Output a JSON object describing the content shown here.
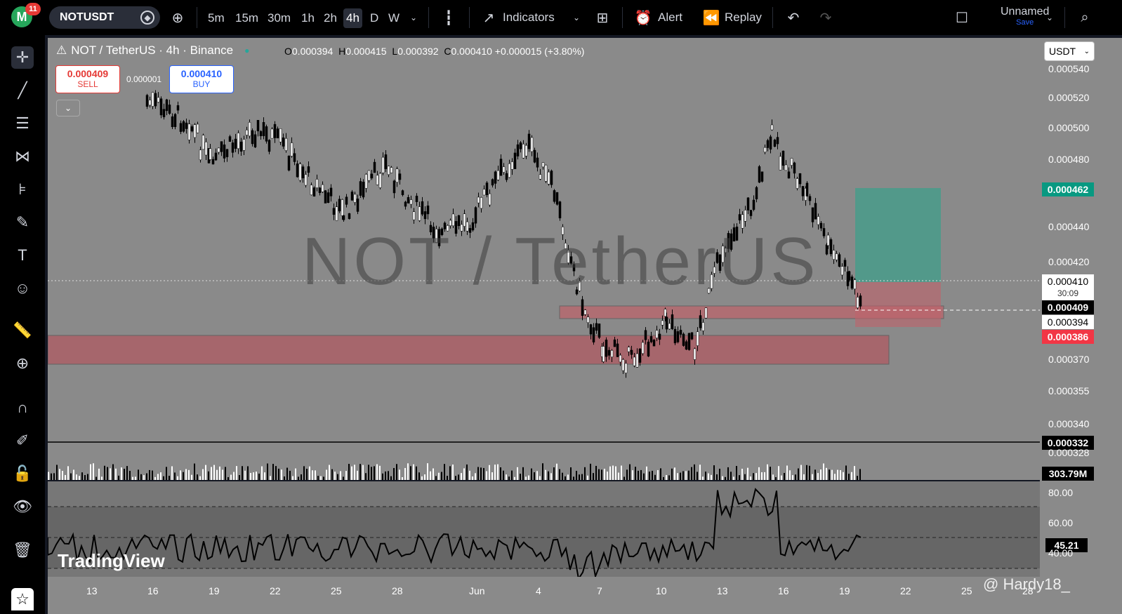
{
  "header": {
    "avatar_letter": "M",
    "notif_count": "11",
    "symbol": "NOTUSDT",
    "timeframes": [
      "5m",
      "15m",
      "30m",
      "1h",
      "2h",
      "4h",
      "D",
      "W"
    ],
    "active_timeframe": "4h",
    "indicators_label": "Indicators",
    "alert_label": "Alert",
    "replay_label": "Replay",
    "layout_name": "Unnamed",
    "save_label": "Save"
  },
  "legend": {
    "title": "NOT / TetherUS · 4h · Binance",
    "o_key": "O",
    "o": "0.000394",
    "h_key": "H",
    "h": "0.000415",
    "l_key": "L",
    "l": "0.000392",
    "c_key": "C",
    "c": "0.000410",
    "change": "+0.000015 (+3.80%)"
  },
  "trade": {
    "sell_price": "0.000409",
    "sell_label": "SELL",
    "buy_price": "0.000410",
    "buy_label": "BUY",
    "spread": "0.000001"
  },
  "watermark": "NOT / TetherUS",
  "currency": "USDT",
  "price_axis": {
    "ticks": [
      "0.000540",
      "0.000520",
      "0.000500",
      "0.000480",
      "0.000440",
      "0.000420",
      "0.000370",
      "0.000355",
      "0.000340",
      "0.000328"
    ],
    "tags": {
      "target": "0.000462",
      "last": "0.000410",
      "countdown": "30:09",
      "bid": "0.000409",
      "open": "0.000394",
      "stop": "0.000386",
      "line": "0.000332",
      "volume": "303.79M"
    },
    "colors": {
      "target": "#089981",
      "stop": "#f23645"
    }
  },
  "rsi_axis": {
    "ticks": [
      "80.00",
      "60.00",
      "40.00"
    ],
    "value": "45.21"
  },
  "time_axis": [
    "13",
    "16",
    "19",
    "22",
    "25",
    "28",
    "Jun",
    "4",
    "7",
    "10",
    "13",
    "16",
    "19",
    "22",
    "25",
    "28"
  ],
  "branding": {
    "logo": "TradingView",
    "credit": "@ Hardy18_"
  }
}
